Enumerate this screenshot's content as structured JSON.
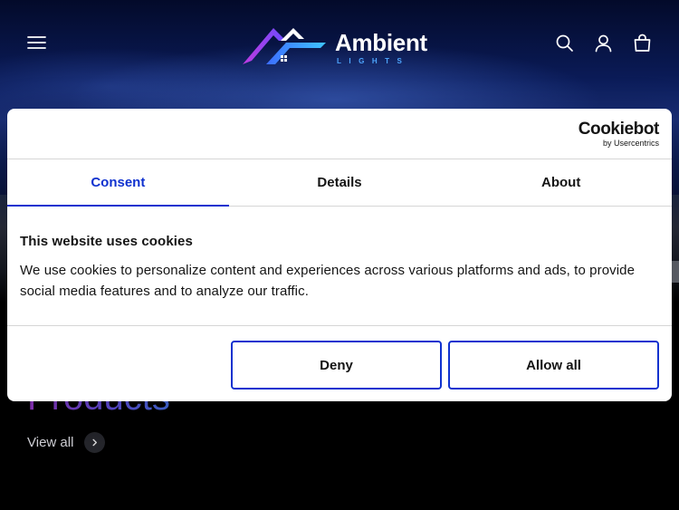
{
  "header": {
    "logo_text": "Ambient",
    "logo_subtext": "LIGHTS"
  },
  "hero": {
    "title": "Products",
    "view_all_label": "View all"
  },
  "cookie_dialog": {
    "brand_name": "Cookiebot",
    "brand_sub": "by Usercentrics",
    "tabs": [
      {
        "label": "Consent",
        "active": true
      },
      {
        "label": "Details",
        "active": false
      },
      {
        "label": "About",
        "active": false
      }
    ],
    "heading": "This website uses cookies",
    "body": "We use cookies to personalize content and experiences across various platforms and ads, to provide social media features and to analyze our traffic.",
    "deny_label": "Deny",
    "allow_label": "Allow all"
  },
  "colors": {
    "accent": "#1032cf",
    "logo_purple": "#8a3ce0",
    "logo_blue": "#4ea6ff"
  },
  "icons": {
    "menu": "hamburger-icon",
    "search": "search-icon",
    "account": "user-icon",
    "cart": "bag-icon",
    "view_all": "chevron-right-icon"
  }
}
